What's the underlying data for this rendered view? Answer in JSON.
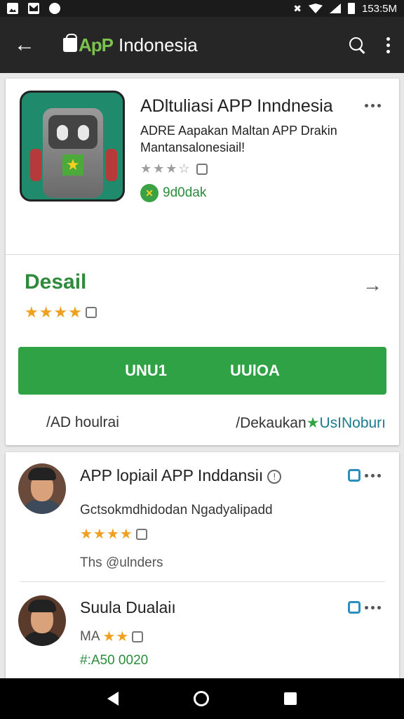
{
  "status_bar": {
    "time": "153:5M"
  },
  "app_bar": {
    "back_label": "←",
    "logo_text": "ApP",
    "title": "Indonesia"
  },
  "app": {
    "name": "ADltuliasi APP Inndnesia",
    "description_line1": "ADRE Aapakan Maltan APP Drakin",
    "description_line2": "Mantansalonesiail!",
    "developer_badge": "✕",
    "developer": "9d0dak",
    "grey_stars": "★★★☆"
  },
  "details": {
    "title": "Desail",
    "stars": "★★★★",
    "install_label_left": "UNU1",
    "install_label_right": "UUlOA",
    "link_left": "/AD houlrai",
    "link_right_prefix": "/Dekaukan",
    "link_right_suffix": "UsINoburı"
  },
  "reviews": [
    {
      "name": "APP lopiail APP Inddansiı",
      "text": "Gctsokmdhidodan Ngadyalipadd",
      "stars": "★★★★",
      "footer": "Ths @ulnders"
    },
    {
      "name": "Suula Dualaiı",
      "rating_prefix": "MA",
      "stars": "★★",
      "price": "#:A50 0020"
    }
  ],
  "colors": {
    "accent_green": "#2fa245",
    "app_bar": "#262626",
    "star_gold": "#f0a020"
  }
}
